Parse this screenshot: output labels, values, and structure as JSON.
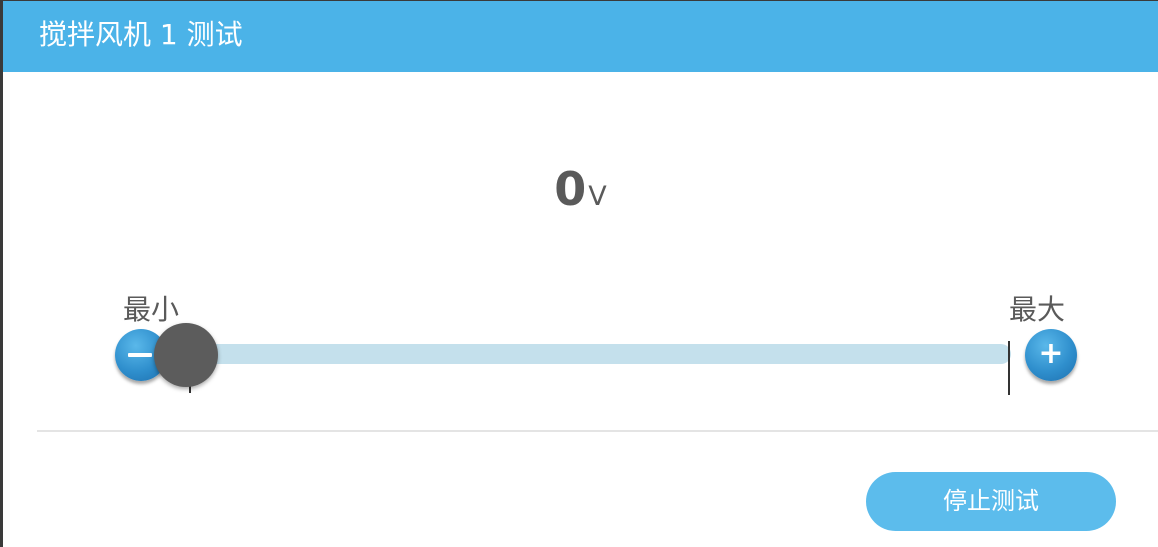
{
  "window": {
    "title": "搅拌风机 1 测试"
  },
  "output": {
    "value": "0",
    "unit": "V"
  },
  "slider": {
    "min_label": "最小",
    "max_label": "最大",
    "level_fraction": 0
  },
  "icons": {
    "decrease": "minus-icon",
    "increase": "plus-icon",
    "plus_glyph": "+"
  },
  "actions": {
    "stop_label": "停止测试"
  },
  "colors": {
    "header": "#4bb3e8",
    "track": "#c4e0ec",
    "thumb": "#5c5c5c",
    "button": "#5cbcec",
    "round_button": "#2f8fcd"
  }
}
